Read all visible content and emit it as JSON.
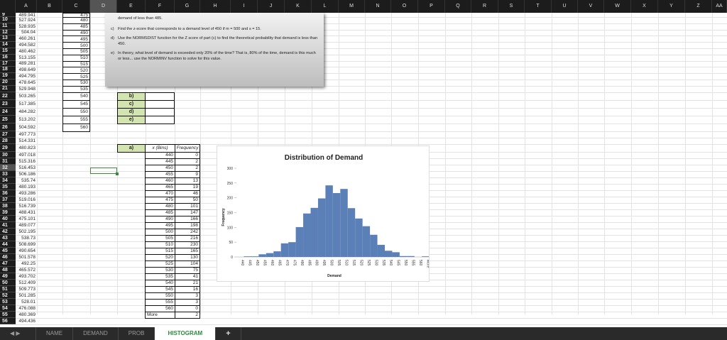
{
  "columns": [
    "A",
    "B",
    "C",
    "D",
    "E",
    "F",
    "G",
    "H",
    "I",
    "J",
    "K",
    "L",
    "M",
    "N",
    "O",
    "P",
    "Q",
    "R",
    "S",
    "T",
    "U",
    "V",
    "W",
    "X",
    "Y",
    "Z",
    "AA"
  ],
  "selected_column": "D",
  "selected_row": 32,
  "row_numbers": [
    9,
    10,
    11,
    12,
    13,
    14,
    15,
    16,
    17,
    18,
    19,
    20,
    21,
    22,
    23,
    24,
    25,
    26,
    27,
    28,
    29,
    30,
    31,
    32,
    33,
    34,
    35,
    36,
    37,
    38,
    39,
    40,
    41,
    42,
    43,
    44,
    45,
    46,
    47,
    48,
    49,
    50,
    51,
    52,
    53,
    54,
    55,
    56
  ],
  "column_a": [
    "489.941",
    "527.924",
    "528.935",
    "504.04",
    "460.261",
    "494.582",
    "480.462",
    "513.155",
    "489.281",
    "498.649",
    "494.795",
    "478.645",
    "529.948",
    "503.265",
    "517.385",
    "484.282",
    "513.202",
    "504.592",
    "497.773",
    "514.331",
    "480.823",
    "497.018",
    "515.316",
    "516.453",
    "506.186",
    "535.74",
    "480.193",
    "493.286",
    "519.016",
    "516.739",
    "488.431",
    "475.101",
    "489.077",
    "502.195",
    "538.73",
    "508.699",
    "490.654",
    "501.578",
    "492.25",
    "465.572",
    "493.702",
    "512.409",
    "509.773",
    "501.285",
    "528.01",
    "476.088",
    "480.369",
    "494.436"
  ],
  "column_c": [
    "475",
    "480",
    "485",
    "490",
    "495",
    "500",
    "505",
    "510",
    "515",
    "520",
    "525",
    "530",
    "535",
    "540",
    "545",
    "550",
    "555",
    "560"
  ],
  "instructions": {
    "line_b": "demand of less than 485.",
    "items": [
      {
        "label": "c)",
        "text": "Find the z-score that corresponds to a demand level of 450 if m = 500 and s = 15."
      },
      {
        "label": "d)",
        "text": "Use the NORMSDIST function for the Z score of part (c) to find the theoretical probability that demand is less than 450."
      },
      {
        "label": "e)",
        "text": "In theory, what level of demand is exceeded only 20% of the time?  That is, 80% of the time, demand is this much or less... use the NORMINV function to solve for this value."
      }
    ]
  },
  "answer_labels": [
    "b)",
    "c)",
    "d)",
    "e)"
  ],
  "table": {
    "label": "a)",
    "header_bins": "x (Bins)",
    "header_freq": "Frequency",
    "bins": [
      "440",
      "445",
      "450",
      "455",
      "460",
      "465",
      "470",
      "475",
      "480",
      "485",
      "490",
      "495",
      "500",
      "505",
      "510",
      "515",
      "520",
      "525",
      "530",
      "535",
      "540",
      "545",
      "550",
      "555",
      "560",
      "More"
    ],
    "freqs": [
      "0",
      "2",
      "2",
      "9",
      "13",
      "19",
      "46",
      "50",
      "101",
      "147",
      "166",
      "198",
      "242",
      "216",
      "230",
      "165",
      "130",
      "104",
      "75",
      "41",
      "21",
      "16",
      "3",
      "3",
      "0",
      "2"
    ]
  },
  "chart_data": {
    "type": "bar",
    "title": "Distribution of Demand",
    "xlabel": "Demand",
    "ylabel": "Frequency",
    "categories": [
      "440",
      "445",
      "450",
      "455",
      "460",
      "465",
      "470",
      "475",
      "480",
      "485",
      "490",
      "495",
      "500",
      "505",
      "510",
      "515",
      "520",
      "525",
      "530",
      "535",
      "540",
      "545",
      "550",
      "555",
      "560",
      "More"
    ],
    "values": [
      0,
      2,
      2,
      9,
      13,
      19,
      46,
      50,
      101,
      147,
      166,
      198,
      242,
      216,
      230,
      165,
      130,
      104,
      75,
      41,
      21,
      16,
      3,
      3,
      0,
      2
    ],
    "yticks": [
      "0",
      "50",
      "100",
      "150",
      "200",
      "250",
      "300"
    ],
    "ylim": [
      0,
      300
    ],
    "bar_color": "#5b80b8",
    "legend": "none"
  },
  "tabs": [
    "NAME",
    "DEMAND",
    "PROB",
    "HISTOGRAM"
  ],
  "active_tab": "HISTOGRAM",
  "add_tab": "+"
}
